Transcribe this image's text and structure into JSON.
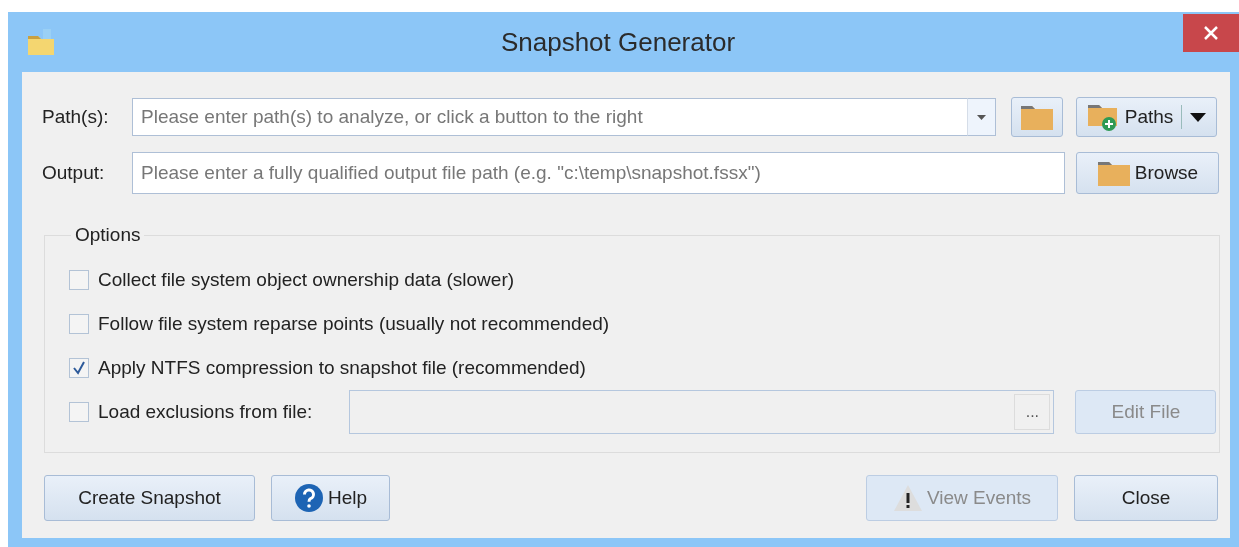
{
  "window": {
    "title": "Snapshot Generator"
  },
  "paths": {
    "label": "Path(s):",
    "placeholder": "Please enter path(s) to analyze, or click a button to the right",
    "paths_button": "Paths"
  },
  "output": {
    "label": "Output:",
    "placeholder": "Please enter a fully qualified output file path (e.g. \"c:\\temp\\snapshot.fssx\")",
    "browse_button": "Browse"
  },
  "options": {
    "title": "Options",
    "items": [
      {
        "kind": "check",
        "label": "Collect file system object ownership data (slower)",
        "checked": false
      },
      {
        "kind": "check",
        "label": "Follow file system reparse points (usually not recommended)",
        "checked": false
      },
      {
        "kind": "check",
        "label": "Apply NTFS compression to snapshot file (recommended)",
        "checked": true
      },
      {
        "kind": "file",
        "label": "Load exclusions from file:",
        "checked": false,
        "field_disabled": true,
        "browse_button": "...",
        "edit_button": {
          "label": "Edit File",
          "disabled": true
        }
      }
    ]
  },
  "buttons": [
    {
      "kind": "plain",
      "label": "Create Snapshot",
      "disabled": false
    },
    {
      "kind": "help",
      "label": "Help",
      "disabled": false
    },
    {
      "kind": "warning",
      "label": "View Events",
      "disabled": true
    },
    {
      "kind": "plain",
      "label": "Close",
      "disabled": false
    }
  ]
}
